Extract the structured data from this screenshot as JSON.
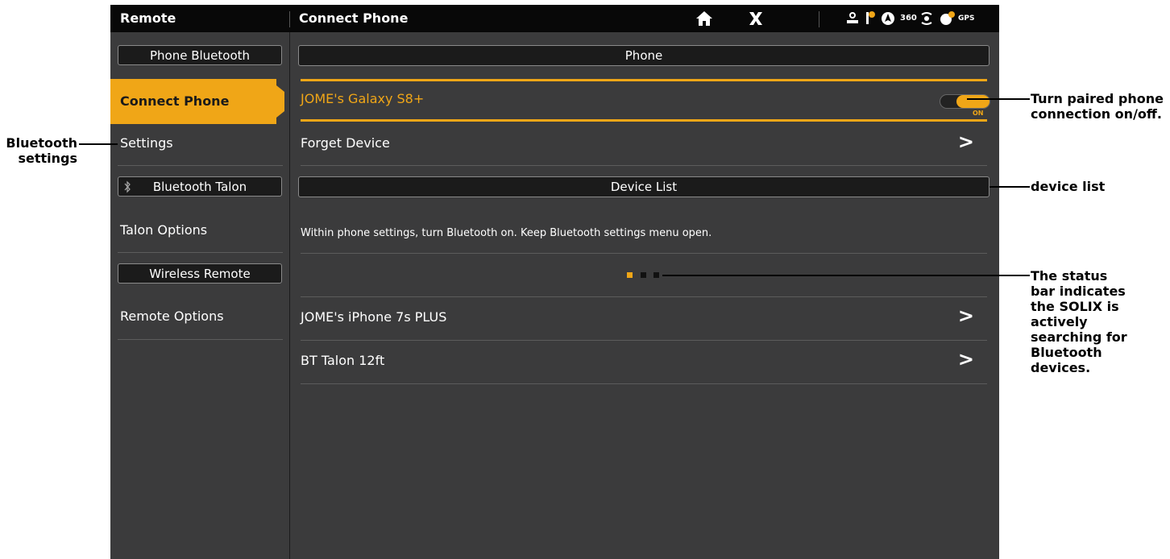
{
  "topbar": {
    "left_title": "Remote",
    "title": "Connect Phone",
    "status_360": "360",
    "status_gps": "GPS"
  },
  "sidebar": {
    "sections": {
      "phone_bluetooth": "Phone Bluetooth",
      "bluetooth_talon": "Bluetooth Talon",
      "wireless_remote": "Wireless Remote"
    },
    "items": {
      "connect_phone": "Connect Phone",
      "settings": "Settings",
      "talon_options": "Talon Options",
      "remote_options": "Remote Options"
    }
  },
  "main": {
    "phone_header": "Phone",
    "paired_device": "JOME's Galaxy S8+",
    "toggle_state": "ON",
    "forget_device": "Forget Device",
    "device_list_header": "Device List",
    "instruction": "Within phone settings, turn Bluetooth on. Keep Bluetooth settings menu open.",
    "chevron": ">",
    "devices": [
      "JOME's iPhone 7s PLUS",
      "BT Talon 12ft"
    ]
  },
  "annotations": {
    "bluetooth_settings": "Bluetooth settings",
    "toggle": "Turn paired phone connection on/off.",
    "device_list": "device list",
    "status_bar": "The status bar indicates the SOLIX is actively searching for Bluetooth devices."
  },
  "colors": {
    "accent": "#f0a617",
    "screen_bg": "#3b3b3c",
    "topbar_bg": "#080808"
  }
}
